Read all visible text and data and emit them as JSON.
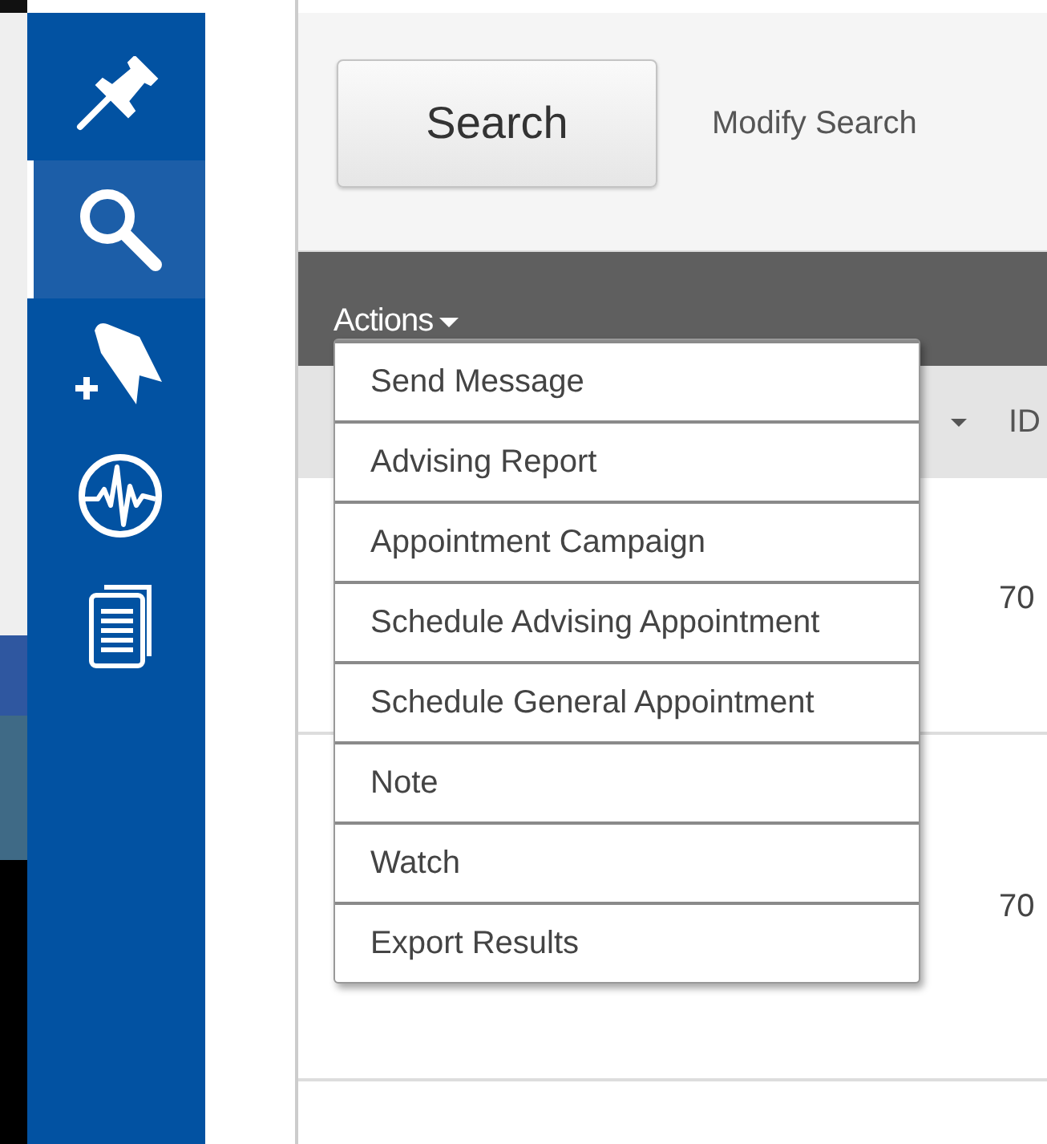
{
  "sidebar": {
    "items": [
      {
        "kind": "pin",
        "selected": false
      },
      {
        "kind": "search",
        "selected": true
      },
      {
        "kind": "bookmark-add",
        "selected": false
      },
      {
        "kind": "pulse",
        "selected": false
      },
      {
        "kind": "documents",
        "selected": false
      }
    ]
  },
  "search_button": "Search",
  "modify_search_link": "Modify Search",
  "actions_menu": {
    "label": "Actions",
    "expanded": true,
    "items": [
      "Send Message",
      "Advising Report",
      "Appointment Campaign",
      "Schedule Advising Appointment",
      "Schedule General Appointment",
      "Note",
      "Watch",
      "Export Results"
    ]
  },
  "table": {
    "id_header": "ID",
    "rows": [
      {
        "id": "70"
      },
      {
        "id": "70"
      }
    ]
  }
}
